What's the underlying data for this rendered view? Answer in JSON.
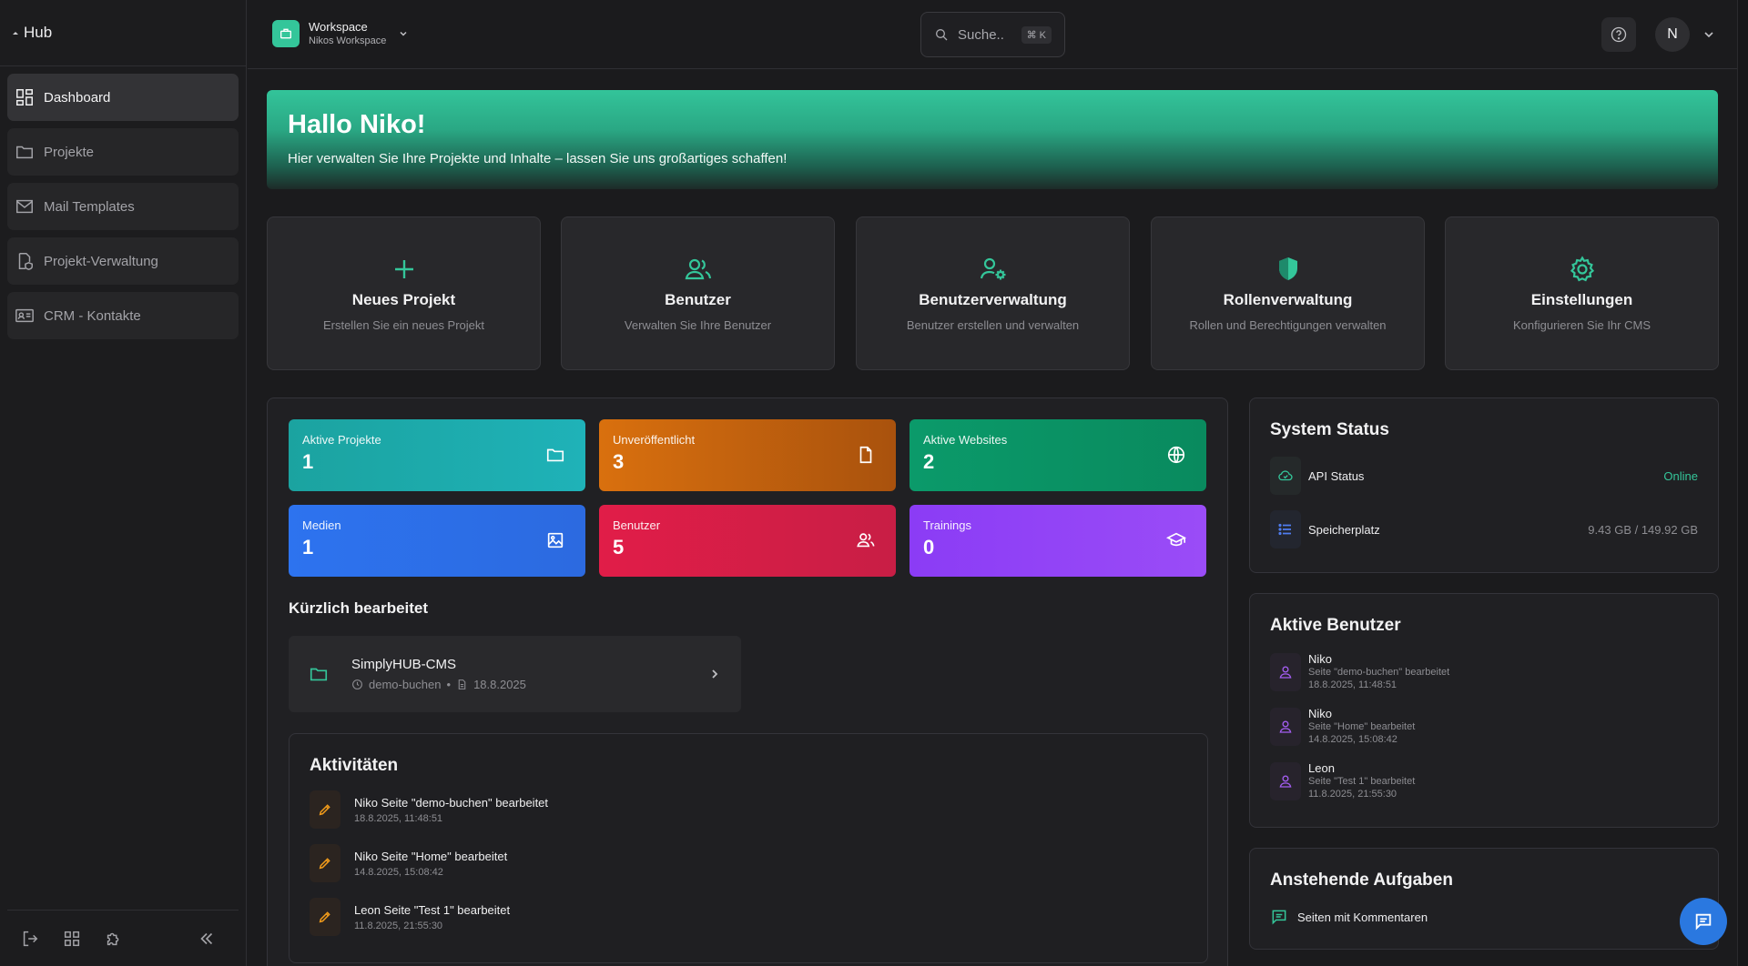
{
  "sidebar": {
    "title": "Hub",
    "items": [
      {
        "label": "Dashboard",
        "icon": "dashboard-icon",
        "active": true
      },
      {
        "label": "Projekte",
        "icon": "folder-icon"
      },
      {
        "label": "Mail Templates",
        "icon": "mail-icon"
      },
      {
        "label": "Projekt-Verwaltung",
        "icon": "shield-file-icon"
      },
      {
        "label": "CRM - Kontakte",
        "icon": "contact-card-icon"
      }
    ]
  },
  "topbar": {
    "workspace_name": "Workspace",
    "workspace_sub": "Nikos Workspace",
    "search_placeholder": "Suche..",
    "search_shortcut": "⌘ K",
    "avatar_initial": "N"
  },
  "hero": {
    "title": "Hallo Niko!",
    "subtitle": "Hier verwalten Sie Ihre Projekte und Inhalte – lassen Sie uns großartiges schaffen!"
  },
  "quick_actions": [
    {
      "title": "Neues Projekt",
      "desc": "Erstellen Sie ein neues Projekt",
      "icon": "plus-icon"
    },
    {
      "title": "Benutzer",
      "desc": "Verwalten Sie Ihre Benutzer",
      "icon": "users-icon"
    },
    {
      "title": "Benutzerverwaltung",
      "desc": "Benutzer erstellen und verwalten",
      "icon": "user-cog-icon"
    },
    {
      "title": "Rollenverwaltung",
      "desc": "Rollen und Berechtigungen verwalten",
      "icon": "shield-icon"
    },
    {
      "title": "Einstellungen",
      "desc": "Konfigurieren Sie Ihr CMS",
      "icon": "gear-icon"
    }
  ],
  "stats": [
    {
      "label": "Aktive Projekte",
      "value": "1",
      "color": "#1ba3a0",
      "icon": "folder-icon"
    },
    {
      "label": "Unveröffentlicht",
      "value": "3",
      "color": "#d9700e",
      "icon": "file-icon"
    },
    {
      "label": "Aktive Websites",
      "value": "2",
      "color": "#0b9a6a",
      "icon": "globe-icon"
    },
    {
      "label": "Medien",
      "value": "1",
      "color": "#2d73ef",
      "icon": "image-icon"
    },
    {
      "label": "Benutzer",
      "value": "5",
      "color": "#e11d48",
      "icon": "users-icon"
    },
    {
      "label": "Trainings",
      "value": "0",
      "color": "#8b3cf5",
      "icon": "graduation-cap-icon"
    }
  ],
  "recent": {
    "heading": "Kürzlich bearbeitet",
    "item": {
      "title": "SimplyHUB-CMS",
      "slug": "demo-buchen",
      "date": "18.8.2025"
    }
  },
  "activities": {
    "heading": "Aktivitäten",
    "items": [
      {
        "text": "Niko Seite \"demo-buchen\" bearbeitet",
        "time": "18.8.2025, 11:48:51"
      },
      {
        "text": "Niko Seite \"Home\" bearbeitet",
        "time": "14.8.2025, 15:08:42"
      },
      {
        "text": "Leon Seite \"Test 1\" bearbeitet",
        "time": "11.8.2025, 21:55:30"
      }
    ]
  },
  "system_status": {
    "heading": "System Status",
    "api_label": "API Status",
    "api_value": "Online",
    "api_color": "#34c69a",
    "storage_label": "Speicherplatz",
    "storage_value": "9.43 GB / 149.92 GB"
  },
  "active_users": {
    "heading": "Aktive Benutzer",
    "items": [
      {
        "name": "Niko",
        "action": "Seite \"demo-buchen\" bearbeitet",
        "time": "18.8.2025, 11:48:51"
      },
      {
        "name": "Niko",
        "action": "Seite \"Home\" bearbeitet",
        "time": "14.8.2025, 15:08:42"
      },
      {
        "name": "Leon",
        "action": "Seite \"Test 1\" bearbeitet",
        "time": "11.8.2025, 21:55:30"
      }
    ]
  },
  "tasks": {
    "heading": "Anstehende Aufgaben",
    "item": "Seiten mit Kommentaren"
  },
  "colors": {
    "accent": "#34c69a",
    "activity_accent": "#f39c1a",
    "user_accent": "#a35df0",
    "fab": "#2a78e0"
  }
}
